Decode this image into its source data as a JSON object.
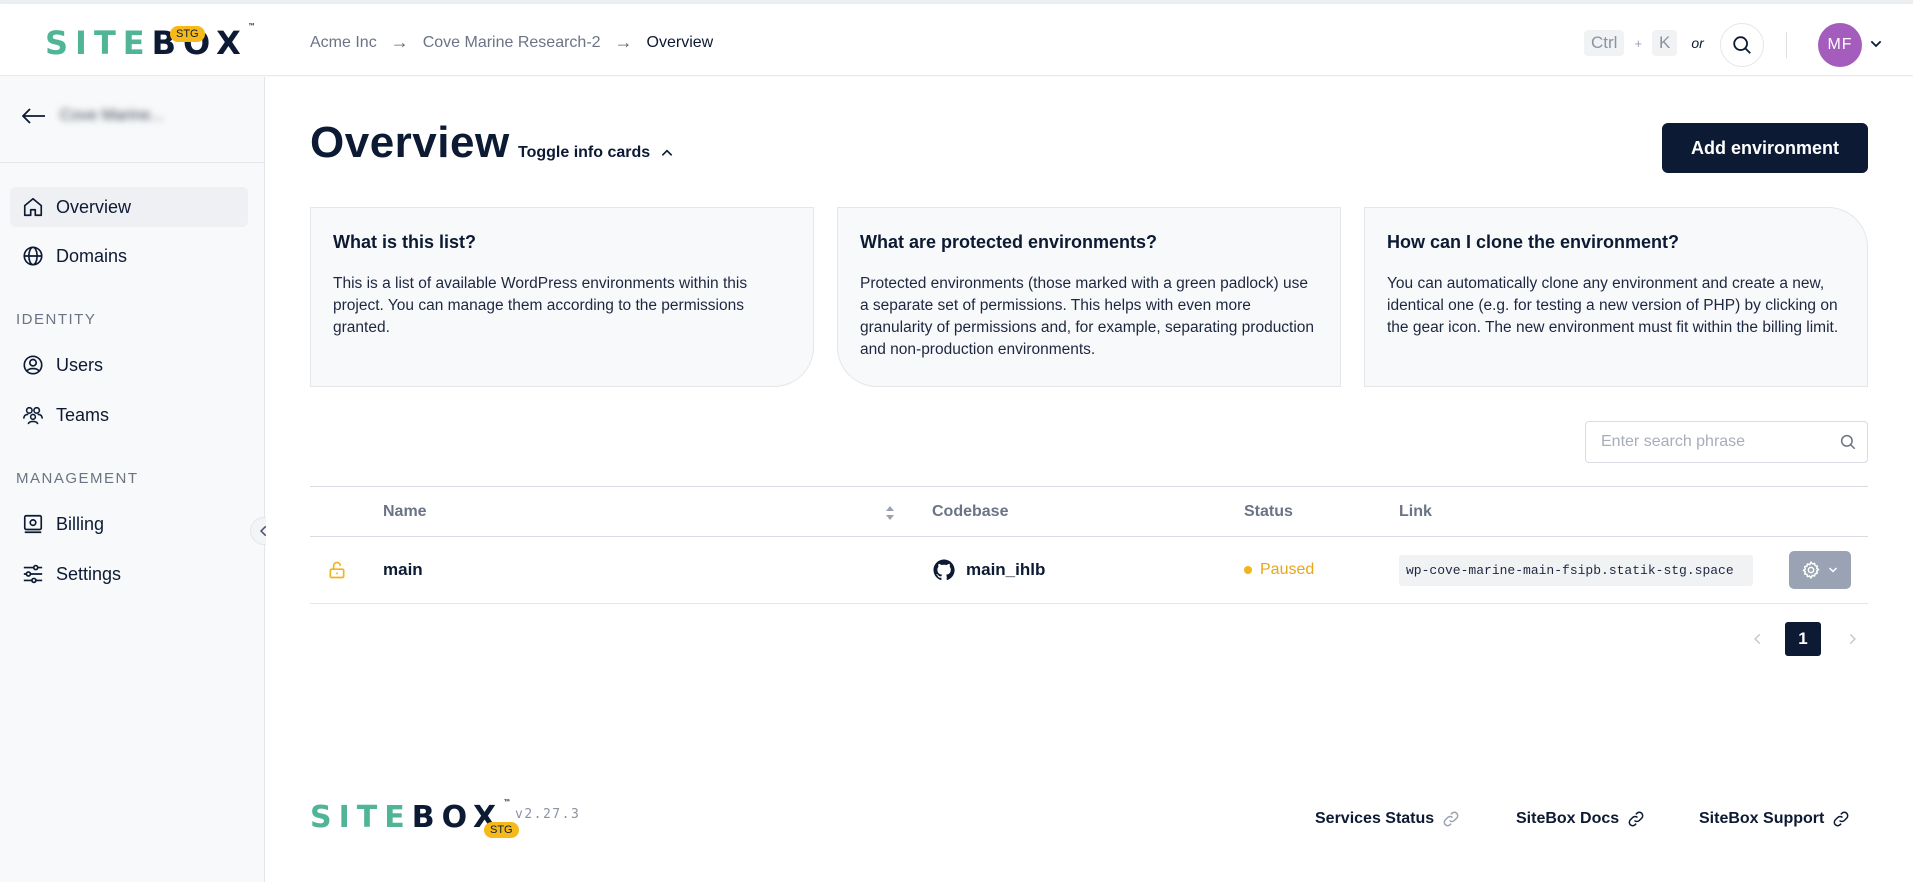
{
  "brand": {
    "logo_part1": "SIT",
    "logo_part2": "E",
    "logo_part3": "BOX",
    "tm": "™",
    "env_badge": "STG"
  },
  "breadcrumb": {
    "items": [
      "Acme Inc",
      "Cove Marine Research-2",
      "Overview"
    ],
    "separator": "→"
  },
  "shortcut": {
    "key1": "Ctrl",
    "plus": "+",
    "key2": "K",
    "or": "or"
  },
  "user": {
    "initials": "MF"
  },
  "sidebar": {
    "project_name": "Cove Marine...",
    "items_main": [
      {
        "label": "Overview",
        "icon": "home-icon",
        "active": true
      },
      {
        "label": "Domains",
        "icon": "globe-icon",
        "active": false
      }
    ],
    "section_identity": "IDENTITY",
    "items_identity": [
      {
        "label": "Users",
        "icon": "user-circle-icon"
      },
      {
        "label": "Teams",
        "icon": "team-icon"
      }
    ],
    "section_management": "MANAGEMENT",
    "items_management": [
      {
        "label": "Billing",
        "icon": "billing-icon"
      },
      {
        "label": "Settings",
        "icon": "sliders-icon"
      }
    ]
  },
  "main": {
    "title": "Overview",
    "toggle_info": "Toggle info cards",
    "add_environment": "Add environment",
    "cards": [
      {
        "title": "What is this list?",
        "body": "This is a list of available WordPress environments within this project. You can manage them according to the permissions granted."
      },
      {
        "title": "What are protected environments?",
        "body": "Protected environments (those marked with a green padlock) use a separate set of permissions. This helps with even more granularity of permissions and, for example, separating production and non-production environments."
      },
      {
        "title": "How can I clone the environment?",
        "body": "You can automatically clone any environment and create a new, identical one (e.g. for testing a new version of PHP) by clicking on the gear icon. The new environment must fit within the billing limit."
      }
    ],
    "search_placeholder": "Enter search phrase",
    "table": {
      "columns": [
        "Name",
        "Codebase",
        "Status",
        "Link"
      ],
      "rows": [
        {
          "name": "main",
          "codebase": "main_ihlb",
          "status": "Paused",
          "link": "wp-cove-marine-main-fsipb.statik-stg.space"
        }
      ]
    },
    "pagination": {
      "current_page": "1"
    }
  },
  "footer": {
    "version": "v2.27.3",
    "links": [
      "Services Status",
      "SiteBox Docs",
      "SiteBox Support"
    ]
  },
  "colors": {
    "brand_green": "#4fb596",
    "navy": "#0c1a33",
    "badge_yellow": "#f6b91a",
    "paused_amber": "#e8a71a",
    "avatar_purple": "#a45dbd"
  }
}
